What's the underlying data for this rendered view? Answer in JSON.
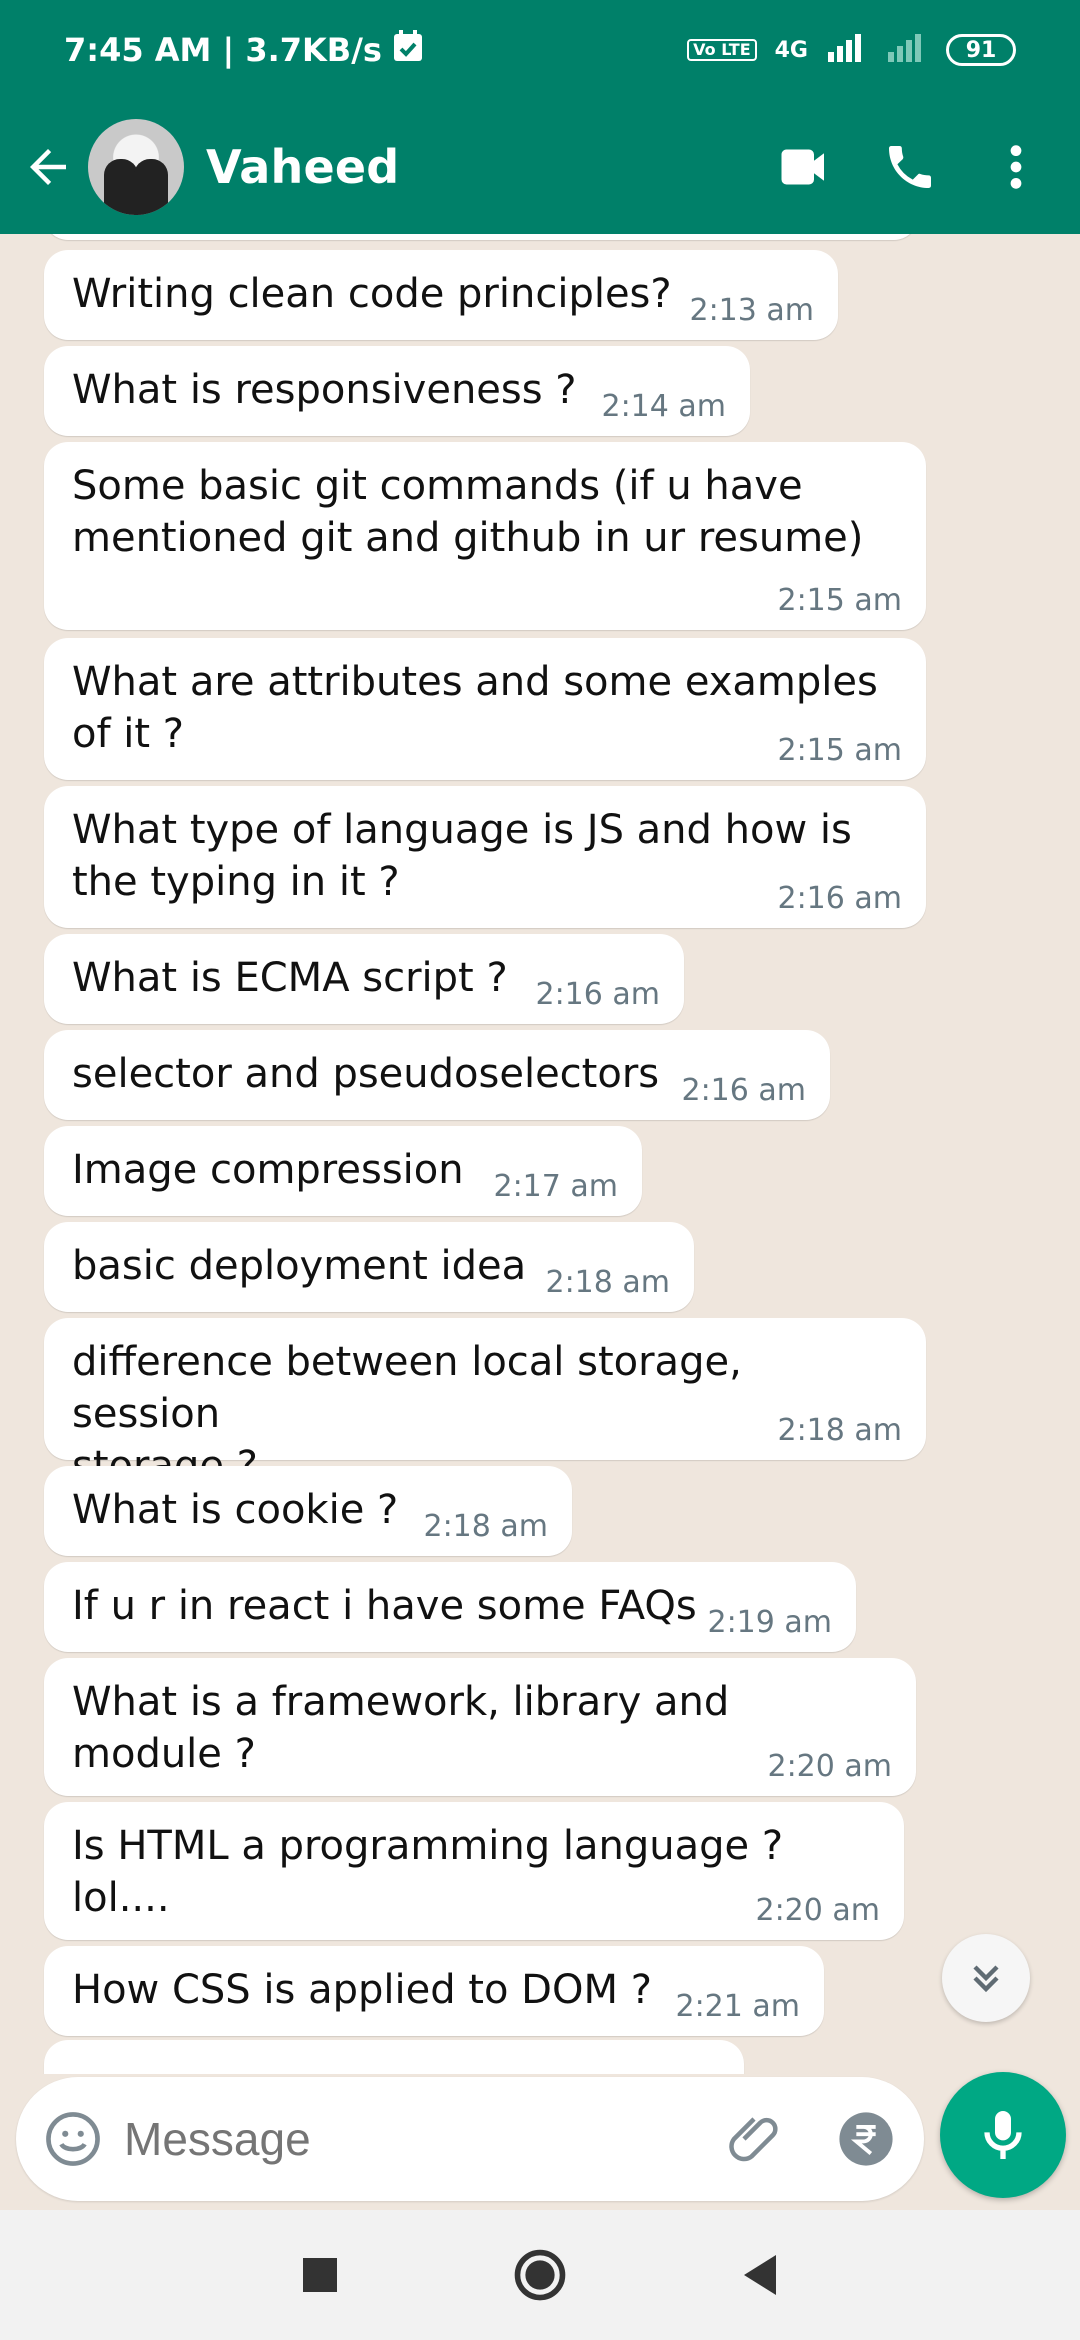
{
  "status_bar": {
    "time": "7:45 AM | 3.7KB/s",
    "volte": "Vo LTE",
    "network": "4G",
    "battery": "91"
  },
  "header": {
    "contact_name": "Vaheed",
    "icons": [
      "back-arrow-icon",
      "video-call-icon",
      "phone-icon",
      "more-icon"
    ]
  },
  "messages": [
    {
      "text": "Writing clean code principles?",
      "time": "2:13 am"
    },
    {
      "text": "What is responsiveness ?",
      "time": "2:14 am"
    },
    {
      "text": "Some basic git commands (if u have\nmentioned git and github in ur resume)",
      "time": "2:15 am"
    },
    {
      "text": "What are attributes and some examples\nof it ?",
      "time": "2:15 am"
    },
    {
      "text": "What type of language is JS and how is\nthe typing in it ?",
      "time": "2:16 am"
    },
    {
      "text": "What is ECMA script ?",
      "time": "2:16 am"
    },
    {
      "text": "selector and pseudoselectors",
      "time": "2:16 am"
    },
    {
      "text": "Image compression",
      "time": "2:17 am"
    },
    {
      "text": "basic deployment idea",
      "time": "2:18 am"
    },
    {
      "text": "difference between local storage, session\nstorage ?",
      "time": "2:18 am"
    },
    {
      "text": "What is cookie ?",
      "time": "2:18 am"
    },
    {
      "text": "If u r in react i have some FAQs",
      "time": "2:19 am"
    },
    {
      "text": "What is a framework, library and module ?",
      "time": "2:20 am"
    },
    {
      "text": "Is HTML a programming language ? lol....",
      "time": "2:20 am"
    },
    {
      "text": "How CSS is applied to DOM ?",
      "time": "2:21 am"
    }
  ],
  "input": {
    "placeholder": "Message"
  },
  "colors": {
    "header_bg": "#008069",
    "mic_bg": "#00a884",
    "chat_bg": "#efe6dd",
    "bubble_bg": "#ffffff",
    "time_color": "#667781"
  }
}
